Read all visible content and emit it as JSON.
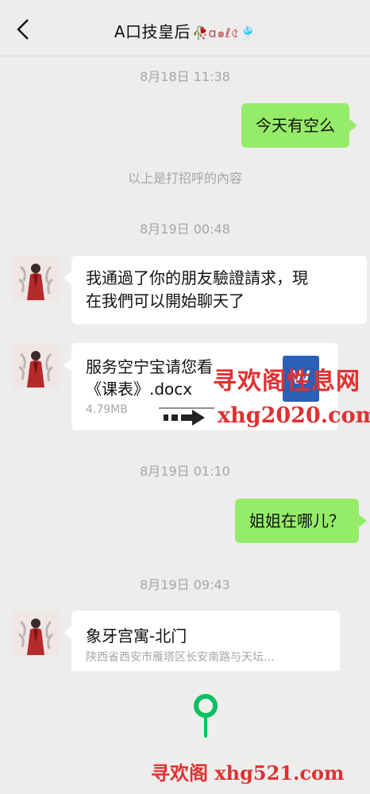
{
  "header": {
    "title": "A口技皇后",
    "title_decor": "🥀ɑ๑ℓ৫🎐",
    "back_icon": "chevron-left-icon"
  },
  "messages": {
    "t1": "8月18日 11:38",
    "m1": "今天有空么",
    "sys1": "以上是打招呼的內容",
    "t2": "8月19日 00:48",
    "m2_line1": "我通過了你的朋友驗證請求，現",
    "m2_line2": "在我們可以開始聊天了",
    "file": {
      "name_line1": "服务空宁宝请您看",
      "name_line2": "《课表》.docx",
      "size": "4.79MB",
      "icon_letter": "W"
    },
    "t3": "8月19日 01:10",
    "m3": "姐姐在哪儿？",
    "t4": "8月19日 09:43",
    "location": {
      "title": "象牙宫寓-北门",
      "address": "陕西省西安市雁塔区长安南路与天坛…"
    }
  },
  "watermarks": {
    "wm1_line1": "寻欢阁性息网",
    "wm1_line2": "xhg2020.com",
    "wm2": "寻欢阁 xhg521.com"
  },
  "colors": {
    "outgoing_bubble": "#95ec69",
    "incoming_bubble": "#ffffff",
    "background": "#ededed",
    "map_pin": "#07c160",
    "file_icon": "#2b5fb4",
    "watermark_red": "#e03030"
  }
}
